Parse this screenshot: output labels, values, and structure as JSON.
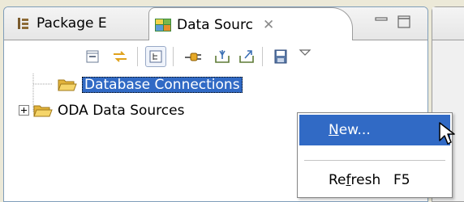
{
  "tabs": {
    "package_explorer": {
      "label": "Package E",
      "icon": "package-explorer-icon"
    },
    "data_source": {
      "label": "Data Sourc",
      "icon": "data-source-explorer-icon",
      "close_glyph": "✕"
    }
  },
  "toolbar": {
    "items": [
      "collapse-all-icon",
      "link-with-editor-icon",
      "tree-view-icon",
      "connect-icon",
      "import-icon",
      "export-icon",
      "save-icon",
      "view-menu-icon"
    ]
  },
  "tree": {
    "items": [
      {
        "label": "Database Connections",
        "selected": true,
        "expander": ""
      },
      {
        "label": "ODA Data Sources",
        "selected": false,
        "expander": "+"
      }
    ]
  },
  "context_menu": {
    "new_pre": "",
    "new_mnemonic": "N",
    "new_post": "ew...",
    "refresh_pre": "Re",
    "refresh_mnemonic": "f",
    "refresh_post": "resh",
    "refresh_accel": "F5"
  },
  "colors": {
    "selection": "#316ac5",
    "folder": "#f5c542",
    "window_bg": "#ece9d8"
  }
}
